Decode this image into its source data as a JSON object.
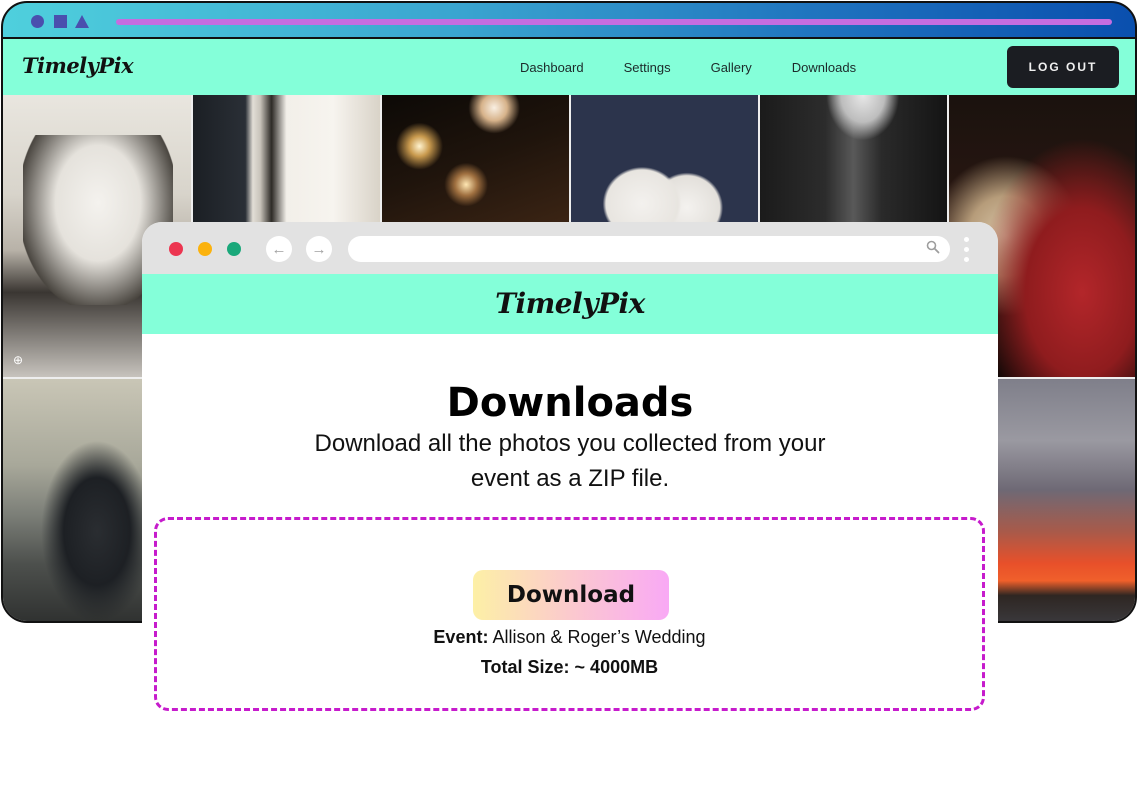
{
  "back_window": {
    "titlebar_shapes": [
      "circle",
      "square",
      "triangle"
    ],
    "logo": "TimelyPix",
    "nav": [
      {
        "label": "Dashboard"
      },
      {
        "label": "Settings"
      },
      {
        "label": "Gallery"
      },
      {
        "label": "Downloads"
      }
    ],
    "logout_label": "LOG OUT",
    "photos": [
      {
        "subject": "groomsmen getting ready"
      },
      {
        "subject": "white bouquet and suit"
      },
      {
        "subject": "sparklers at night"
      },
      {
        "subject": "couple in white on navy backdrop"
      },
      {
        "subject": "black and white tree-lined path"
      },
      {
        "subject": "couple in traditional red attire"
      },
      {
        "subject": "black sports car in fog"
      },
      {
        "subject": "sunset sky with white car"
      }
    ],
    "colors": {
      "nav_bg": "#84ffd9",
      "titlebar_accent": "#c56de0",
      "titlebar_shapes": "#4a4fae",
      "logout_bg": "#1b1d22"
    }
  },
  "front_window": {
    "traffic_lights": {
      "red": "#ec3550",
      "yellow": "#fbb20d",
      "green": "#1aa87a"
    },
    "back_icon": "←",
    "forward_icon": "→",
    "url": "",
    "search_icon": "⚲",
    "logo": "TimelyPix"
  },
  "content": {
    "title": "Downloads",
    "description": "Download all the photos you collected from your event as a ZIP file.",
    "download_label": "Download",
    "event_label": "Event:",
    "event_value": "Allison & Roger’s Wedding",
    "size_text": "Total Size: ~ 4000MB",
    "box_border_color": "#c61bcc"
  }
}
